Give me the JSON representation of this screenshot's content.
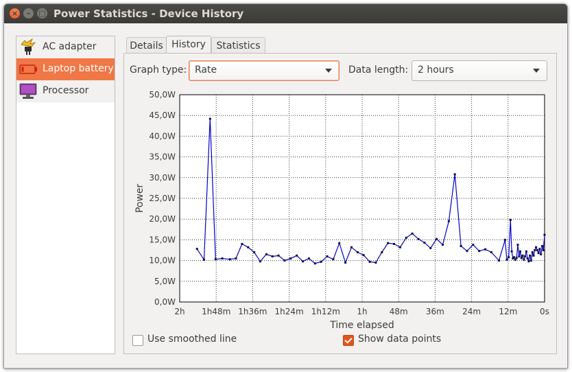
{
  "window": {
    "title": "Power Statistics - Device History",
    "buttons": [
      "close-icon",
      "minimize-icon",
      "maximize-icon"
    ]
  },
  "devices": [
    {
      "label": "AC adapter",
      "icon": "ac-adapter-icon",
      "selected": false
    },
    {
      "label": "Laptop battery",
      "icon": "battery-icon",
      "selected": true
    },
    {
      "label": "Processor",
      "icon": "processor-icon",
      "selected": false
    }
  ],
  "tabs": [
    {
      "label": "Details",
      "active": false
    },
    {
      "label": "History",
      "active": true
    },
    {
      "label": "Statistics",
      "active": false
    }
  ],
  "controls": {
    "graph_type_label": "Graph type:",
    "graph_type_value": "Rate",
    "data_length_label": "Data length:",
    "data_length_value": "2 hours",
    "smoothed_label": "Use smoothed line",
    "smoothed_checked": false,
    "points_label": "Show data points",
    "points_checked": true
  },
  "colors": {
    "accent": "#e2531e",
    "selection": "#f07746",
    "line": "#0000c8",
    "titlebar": "#3c3b37"
  },
  "chart_data": {
    "type": "line",
    "title": "",
    "xlabel": "Time elapsed",
    "ylabel": "Power",
    "x_unit": "minutes elapsed",
    "xlim": [
      120,
      0
    ],
    "ylim": [
      0,
      50
    ],
    "grid": true,
    "legend": "none",
    "x_ticks": [
      {
        "value": 120,
        "label": "2h"
      },
      {
        "value": 108,
        "label": "1h48m"
      },
      {
        "value": 96,
        "label": "1h36m"
      },
      {
        "value": 84,
        "label": "1h24m"
      },
      {
        "value": 72,
        "label": "1h12m"
      },
      {
        "value": 60,
        "label": "1h"
      },
      {
        "value": 48,
        "label": "48m"
      },
      {
        "value": 36,
        "label": "36m"
      },
      {
        "value": 24,
        "label": "24m"
      },
      {
        "value": 12,
        "label": "12m"
      },
      {
        "value": 0,
        "label": "0s"
      }
    ],
    "y_ticks": [
      {
        "value": 50,
        "label": "50,0W"
      },
      {
        "value": 45,
        "label": "45,0W"
      },
      {
        "value": 40,
        "label": "40,0W"
      },
      {
        "value": 35,
        "label": "35,0W"
      },
      {
        "value": 30,
        "label": "30,0W"
      },
      {
        "value": 25,
        "label": "25,0W"
      },
      {
        "value": 20,
        "label": "20,0W"
      },
      {
        "value": 15,
        "label": "15,0W"
      },
      {
        "value": 10,
        "label": "10,0W"
      },
      {
        "value": 5,
        "label": "5,0W"
      },
      {
        "value": 0,
        "label": "0,0W"
      }
    ],
    "series": [
      {
        "points": [
          [
            114.3,
            12.8
          ],
          [
            112.0,
            10.2
          ],
          [
            110.0,
            44.2
          ],
          [
            108.2,
            10.3
          ],
          [
            106.0,
            10.5
          ],
          [
            103.5,
            10.3
          ],
          [
            101.5,
            10.5
          ],
          [
            99.5,
            14.0
          ],
          [
            97.5,
            13.2
          ],
          [
            95.5,
            12.0
          ],
          [
            93.5,
            9.8
          ],
          [
            91.5,
            11.5
          ],
          [
            89.5,
            11.0
          ],
          [
            87.5,
            11.2
          ],
          [
            85.5,
            10.0
          ],
          [
            83.5,
            10.5
          ],
          [
            81.5,
            11.2
          ],
          [
            79.5,
            9.8
          ],
          [
            77.5,
            10.5
          ],
          [
            75.5,
            9.3
          ],
          [
            73.5,
            9.7
          ],
          [
            71.5,
            11.0
          ],
          [
            69.5,
            10.3
          ],
          [
            67.5,
            14.2
          ],
          [
            65.5,
            9.5
          ],
          [
            63.5,
            13.2
          ],
          [
            61.5,
            12.0
          ],
          [
            59.5,
            11.3
          ],
          [
            57.5,
            9.7
          ],
          [
            55.5,
            9.5
          ],
          [
            53.5,
            12.0
          ],
          [
            51.5,
            14.2
          ],
          [
            49.5,
            14.0
          ],
          [
            47.5,
            13.2
          ],
          [
            45.5,
            15.5
          ],
          [
            43.5,
            16.5
          ],
          [
            41.5,
            15.2
          ],
          [
            39.5,
            14.3
          ],
          [
            37.5,
            13.0
          ],
          [
            35.5,
            15.2
          ],
          [
            33.5,
            13.8
          ],
          [
            31.5,
            19.5
          ],
          [
            29.5,
            30.8
          ],
          [
            27.5,
            13.5
          ],
          [
            25.5,
            12.3
          ],
          [
            23.5,
            13.8
          ],
          [
            21.5,
            12.3
          ],
          [
            19.5,
            12.7
          ],
          [
            17.5,
            12.0
          ],
          [
            15.0,
            10.0
          ],
          [
            13.0,
            15.0
          ],
          [
            12.4,
            10.2
          ],
          [
            11.8,
            10.8
          ],
          [
            11.2,
            19.8
          ],
          [
            10.8,
            12.2
          ],
          [
            10.4,
            10.5
          ],
          [
            10.0,
            10.8
          ],
          [
            9.6,
            10.2
          ],
          [
            9.2,
            10.6
          ],
          [
            8.8,
            13.8
          ],
          [
            8.4,
            11.0
          ],
          [
            8.0,
            12.2
          ],
          [
            7.6,
            10.6
          ],
          [
            7.2,
            11.2
          ],
          [
            6.8,
            10.2
          ],
          [
            6.4,
            11.0
          ],
          [
            6.0,
            12.2
          ],
          [
            5.6,
            10.5
          ],
          [
            5.2,
            9.8
          ],
          [
            4.8,
            11.2
          ],
          [
            4.4,
            10.0
          ],
          [
            4.0,
            12.0
          ],
          [
            3.6,
            11.2
          ],
          [
            3.2,
            12.5
          ],
          [
            2.8,
            13.2
          ],
          [
            2.4,
            12.5
          ],
          [
            2.0,
            11.8
          ],
          [
            1.6,
            12.8
          ],
          [
            1.2,
            11.5
          ],
          [
            0.8,
            13.5
          ],
          [
            0.4,
            12.5
          ],
          [
            0.0,
            16.2
          ]
        ]
      }
    ]
  }
}
